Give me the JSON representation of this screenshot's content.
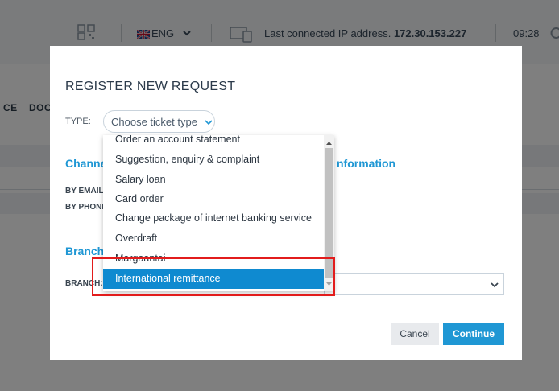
{
  "topbar": {
    "qr_icon": "qr-code-icon",
    "language": "ENG",
    "ip_label": "Last connected IP address.",
    "ip_value": "172.30.153.227",
    "time": "09:28"
  },
  "nav": {
    "items": [
      "CE",
      "DOC"
    ]
  },
  "modal": {
    "title": "REGISTER NEW REQUEST",
    "type_label": "TYPE:",
    "type_select_value": "Choose ticket type",
    "channel_section": "Channe",
    "by_email_label": "BY EMAIL",
    "by_phone_label": "BY PHONI",
    "information_section": "nformation",
    "branch_section": "Branch",
    "branch_label": "BRANCH:",
    "cancel_label": "Cancel",
    "continue_label": "Continue"
  },
  "dropdown": {
    "options": [
      "Order an account statement",
      "Suggestion, enquiry & complaint",
      "Salary loan",
      "Card order",
      "Change package of internet banking service",
      "Overdraft",
      "Margaantai",
      "International remittance"
    ],
    "selected_index": 7
  },
  "colors": {
    "accent": "#1f97d4",
    "selected_option": "#0f8ad0",
    "highlight_border": "#e21c1c"
  }
}
